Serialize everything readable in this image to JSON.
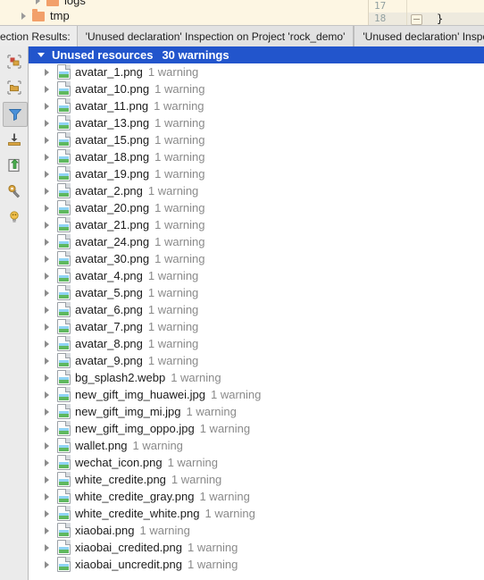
{
  "project_tree": {
    "rows": [
      {
        "label": "logs",
        "icon": "folder-icon"
      },
      {
        "label": "tmp",
        "icon": "folder-icon"
      }
    ]
  },
  "editor": {
    "lines": [
      {
        "number": "17",
        "code": ""
      },
      {
        "number": "18",
        "code": "}"
      }
    ]
  },
  "tabbar": {
    "label": "ection Results:",
    "tabs": [
      {
        "label": "'Unused declaration' Inspection on Project 'rock_demo'"
      },
      {
        "label": "'Unused declaration' Inspection"
      }
    ]
  },
  "toolbar": {
    "buttons": [
      {
        "name": "group-by-modules-icon",
        "selected": false
      },
      {
        "name": "group-by-directory-icon",
        "selected": false
      },
      {
        "name": "filter-icon",
        "selected": true
      },
      {
        "name": "export-to-file-icon",
        "selected": false
      },
      {
        "name": "open-in-editor-icon",
        "selected": false
      },
      {
        "name": "settings-wrench-icon",
        "selected": false
      },
      {
        "name": "lightbulb-icon",
        "selected": false
      }
    ]
  },
  "results": {
    "header": {
      "title": "Unused resources",
      "count": "30 warnings"
    },
    "warning_label": "1 warning",
    "items": [
      {
        "file": "avatar_1.png",
        "warning": "1 warning"
      },
      {
        "file": "avatar_10.png",
        "warning": "1 warning"
      },
      {
        "file": "avatar_11.png",
        "warning": "1 warning"
      },
      {
        "file": "avatar_13.png",
        "warning": "1 warning"
      },
      {
        "file": "avatar_15.png",
        "warning": "1 warning"
      },
      {
        "file": "avatar_18.png",
        "warning": "1 warning"
      },
      {
        "file": "avatar_19.png",
        "warning": "1 warning"
      },
      {
        "file": "avatar_2.png",
        "warning": "1 warning"
      },
      {
        "file": "avatar_20.png",
        "warning": "1 warning"
      },
      {
        "file": "avatar_21.png",
        "warning": "1 warning"
      },
      {
        "file": "avatar_24.png",
        "warning": "1 warning"
      },
      {
        "file": "avatar_30.png",
        "warning": "1 warning"
      },
      {
        "file": "avatar_4.png",
        "warning": "1 warning"
      },
      {
        "file": "avatar_5.png",
        "warning": "1 warning"
      },
      {
        "file": "avatar_6.png",
        "warning": "1 warning"
      },
      {
        "file": "avatar_7.png",
        "warning": "1 warning"
      },
      {
        "file": "avatar_8.png",
        "warning": "1 warning"
      },
      {
        "file": "avatar_9.png",
        "warning": "1 warning"
      },
      {
        "file": "bg_splash2.webp",
        "warning": "1 warning"
      },
      {
        "file": "new_gift_img_huawei.jpg",
        "warning": "1 warning"
      },
      {
        "file": "new_gift_img_mi.jpg",
        "warning": "1 warning"
      },
      {
        "file": "new_gift_img_oppo.jpg",
        "warning": "1 warning"
      },
      {
        "file": "wallet.png",
        "warning": "1 warning"
      },
      {
        "file": "wechat_icon.png",
        "warning": "1 warning"
      },
      {
        "file": "white_credite.png",
        "warning": "1 warning"
      },
      {
        "file": "white_credite_gray.png",
        "warning": "1 warning"
      },
      {
        "file": "white_credite_white.png",
        "warning": "1 warning"
      },
      {
        "file": "xiaobai.png",
        "warning": "1 warning"
      },
      {
        "file": "xiaobai_credited.png",
        "warning": "1 warning"
      },
      {
        "file": "xiaobai_uncredit.png",
        "warning": "1 warning"
      }
    ]
  },
  "colors": {
    "selection_blue": "#2255cc",
    "editor_bg": "#fdf6e3",
    "panel_bg": "#ebebeb",
    "tree_bg": "#ffffff",
    "warning_text": "#8a8a8a"
  }
}
